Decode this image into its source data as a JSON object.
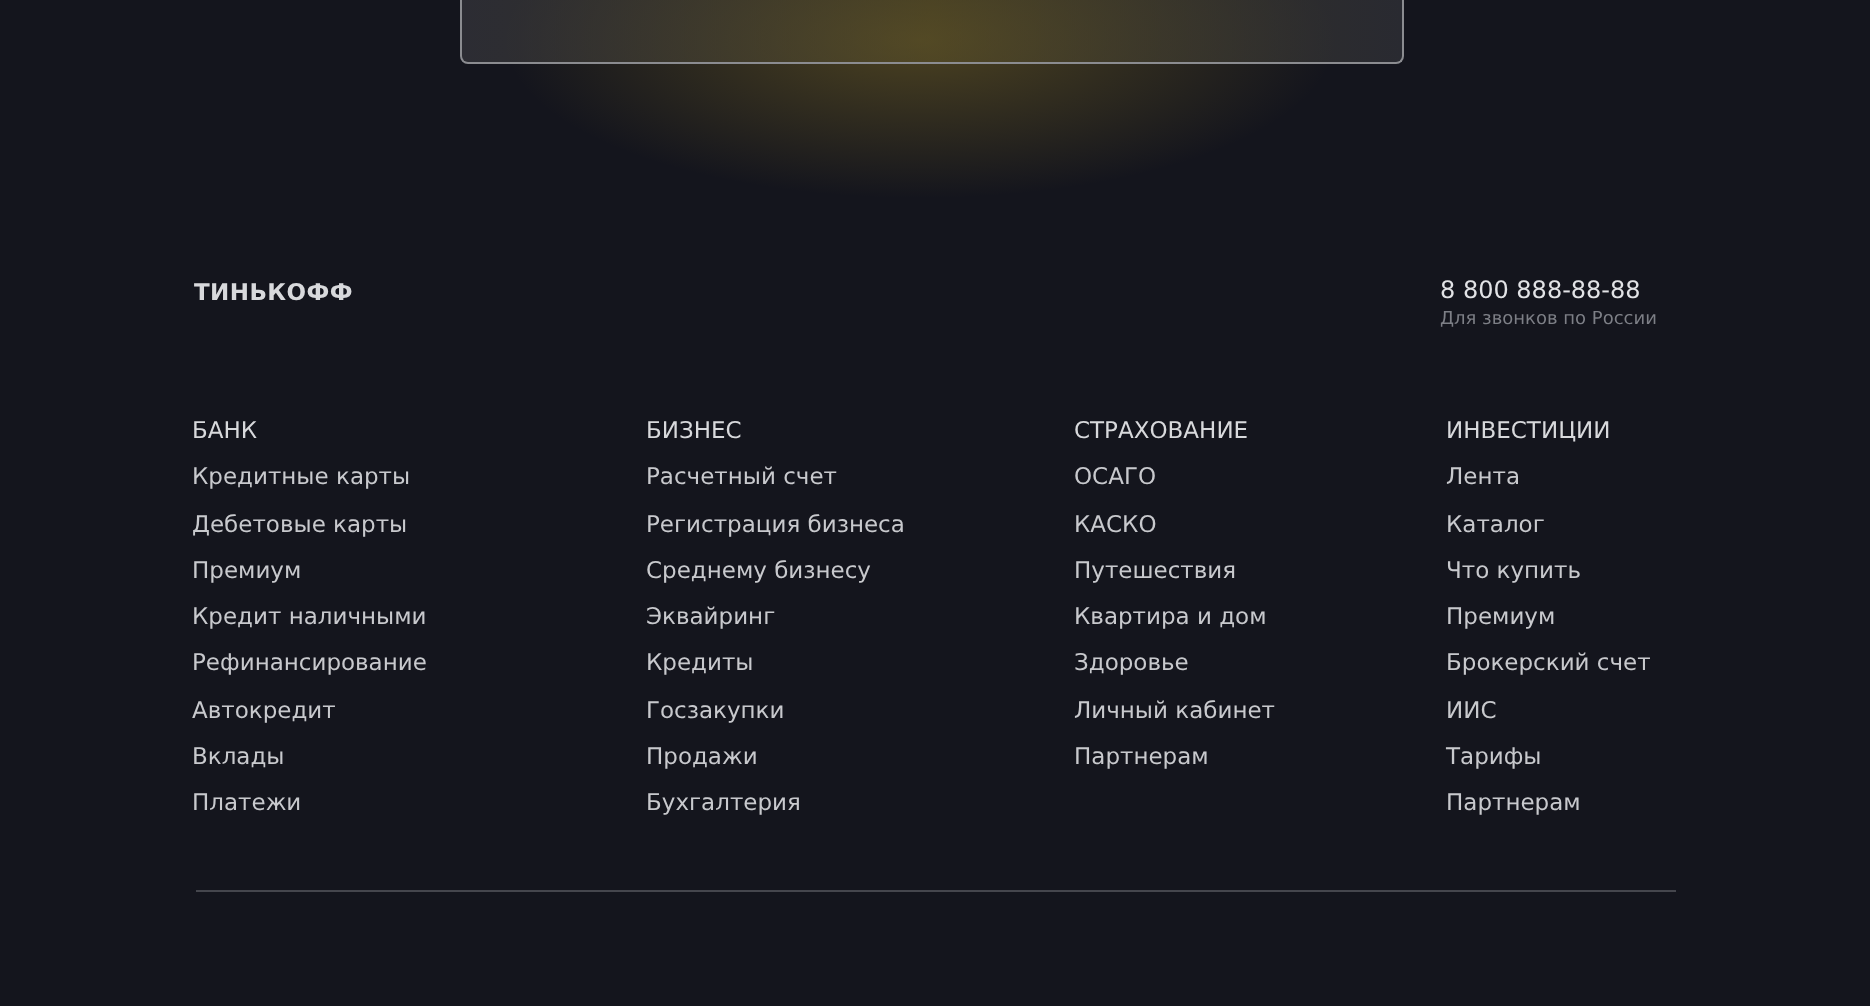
{
  "logo": "ТИНЬКОФФ",
  "contact": {
    "phone": "8 800 888-88-88",
    "note": "Для звонков по России"
  },
  "columns": [
    {
      "title": "БАНК",
      "links": [
        "Кредитные карты",
        "Дебетовые карты",
        "Премиум",
        "Кредит наличными",
        "Рефинансирование",
        "Автокредит",
        "Вклады",
        "Платежи"
      ]
    },
    {
      "title": "БИЗНЕС",
      "links": [
        "Расчетный счет",
        "Регистрация бизнеса",
        "Среднему бизнесу",
        "Эквайринг",
        "Кредиты",
        "Госзакупки",
        "Продажи",
        "Бухгалтерия"
      ]
    },
    {
      "title": "СТРАХОВАНИЕ",
      "links": [
        "ОСАГО",
        "КАСКО",
        "Путешествия",
        "Квартира и дом",
        "Здоровье",
        "Личный кабинет",
        "Партнерам"
      ]
    },
    {
      "title": "ИНВЕСТИЦИИ",
      "links": [
        "Лента",
        "Каталог",
        "Что купить",
        "Премиум",
        "Брокерский счет",
        "ИИС",
        "Тарифы",
        "Партнерам"
      ]
    }
  ]
}
